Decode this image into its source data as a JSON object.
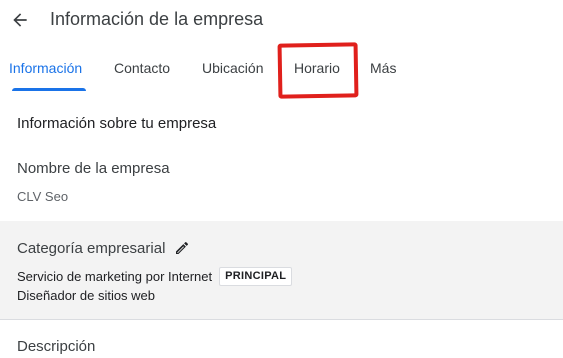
{
  "header": {
    "title": "Información de la empresa",
    "back_icon": "arrow-left-icon"
  },
  "tabs": [
    {
      "label": "Información",
      "active": true
    },
    {
      "label": "Contacto",
      "active": false
    },
    {
      "label": "Ubicación",
      "active": false
    },
    {
      "label": "Horario",
      "active": false,
      "highlighted": true
    },
    {
      "label": "Más",
      "active": false
    }
  ],
  "section": {
    "heading": "Información sobre tu empresa"
  },
  "business_name": {
    "label": "Nombre de la empresa",
    "value": "CLV Seo"
  },
  "category": {
    "label": "Categoría empresarial",
    "edit_icon": "pencil-icon",
    "primary": {
      "name": "Servicio de marketing por Internet",
      "badge": "PRINCIPAL"
    },
    "secondary": [
      "Diseñador de sitios web"
    ]
  },
  "description": {
    "label": "Descripción"
  },
  "colors": {
    "accent": "#1a73e8",
    "highlight": "#e0201c",
    "category_bg": "#f3f3f3"
  }
}
